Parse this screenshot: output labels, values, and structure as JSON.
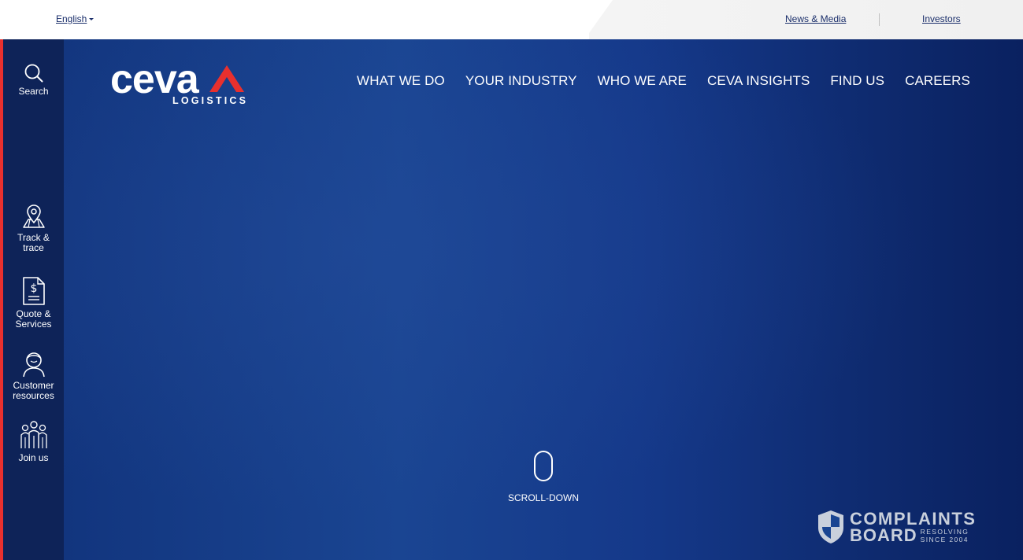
{
  "topbar": {
    "language": "English",
    "news_media": "News & Media",
    "investors": "Investors"
  },
  "sidebar": {
    "items": [
      {
        "label": "Search",
        "icon": "search-icon"
      },
      {
        "label": "Track & trace",
        "icon": "map-pin-icon"
      },
      {
        "label": "Quote & Services",
        "icon": "dollar-document-icon"
      },
      {
        "label": "Customer resources",
        "icon": "user-icon"
      },
      {
        "label": "Join us",
        "icon": "team-icon"
      }
    ]
  },
  "header": {
    "logo_text": "ceva",
    "logo_sub": "LOGISTICS",
    "nav": [
      {
        "label": "WHAT WE DO"
      },
      {
        "label": "YOUR INDUSTRY"
      },
      {
        "label": "WHO WE ARE"
      },
      {
        "label": "CEVA INSIGHTS"
      },
      {
        "label": "FIND US"
      },
      {
        "label": "CAREERS"
      }
    ]
  },
  "hero": {
    "scroll_label": "SCROLL-DOWN"
  },
  "badge": {
    "line1": "COMPLAINTS",
    "line2": "BOARD",
    "tag1": "RESOLVING",
    "tag2": "SINCE 2004"
  },
  "colors": {
    "brand_navy": "#0e2358",
    "brand_red": "#e8302e",
    "hero_blue": "#1a4592"
  }
}
